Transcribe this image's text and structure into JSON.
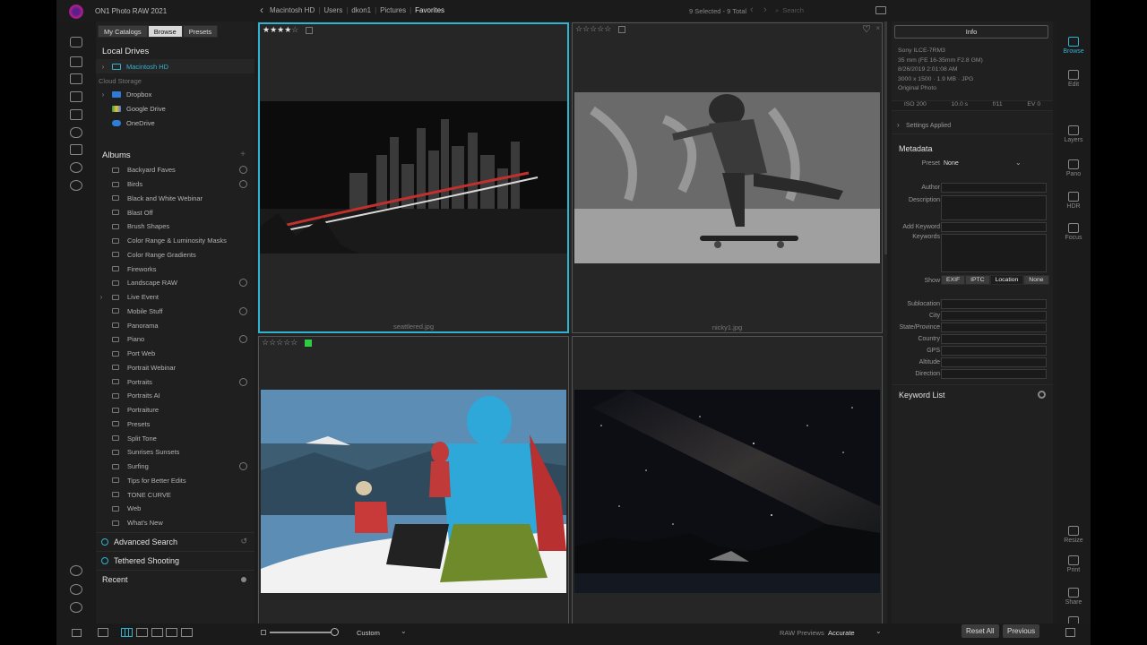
{
  "app_title": "ON1 Photo RAW 2021",
  "breadcrumb": [
    "Macintosh HD",
    "Users",
    "dkon1",
    "Pictures",
    "Favorites"
  ],
  "selection_info": "9 Selected - 9 Total",
  "search_placeholder": "Search",
  "sidebar": {
    "tabs": [
      "My Catalogs",
      "Browse",
      "Presets"
    ],
    "active_tab": "Browse",
    "local_drives_title": "Local Drives",
    "local_drives": [
      {
        "label": "Macintosh HD",
        "selected": true
      }
    ],
    "cloud_storage_title": "Cloud Storage",
    "cloud_storage": [
      {
        "label": "Dropbox",
        "color": "#2f7bd8"
      },
      {
        "label": "Google Drive",
        "color": "#f2c12e"
      },
      {
        "label": "OneDrive",
        "color": "#2c7fd6"
      }
    ],
    "albums_title": "Albums",
    "albums": [
      {
        "label": "Backyard Faves",
        "target": true
      },
      {
        "label": "Birds",
        "target": true
      },
      {
        "label": "Black and White Webinar"
      },
      {
        "label": "Blast Off"
      },
      {
        "label": "Brush Shapes"
      },
      {
        "label": "Color Range & Luminosity Masks"
      },
      {
        "label": "Color Range Gradients"
      },
      {
        "label": "Fireworks"
      },
      {
        "label": "Landscape RAW",
        "target": true
      },
      {
        "label": "Live Event",
        "expandable": true
      },
      {
        "label": "Mobile Stuff",
        "target": true
      },
      {
        "label": "Panorama"
      },
      {
        "label": "Piano",
        "target": true
      },
      {
        "label": "Port Web"
      },
      {
        "label": "Portrait Webinar"
      },
      {
        "label": "Portraits",
        "target": true
      },
      {
        "label": "Portraits AI"
      },
      {
        "label": "Portraiture"
      },
      {
        "label": "Presets"
      },
      {
        "label": "Split Tone"
      },
      {
        "label": "Sunrises Sunsets"
      },
      {
        "label": "Surfing",
        "target": true
      },
      {
        "label": "Tips for Better Edits"
      },
      {
        "label": "TONE CURVE"
      },
      {
        "label": "Web"
      },
      {
        "label": "What's New"
      }
    ],
    "advanced_search": "Advanced Search",
    "tethered_shooting": "Tethered Shooting",
    "recent": "Recent"
  },
  "grid": {
    "cells": [
      {
        "filename": "seattlered.jpg",
        "rating": 4,
        "selected": true,
        "photo": "city-night"
      },
      {
        "filename": "nicky1.jpg",
        "rating": 0,
        "favorite_icon": "heart-icon",
        "photo": "skateboarder"
      },
      {
        "filename": "",
        "rating": 0,
        "color_label": "#2ecc40",
        "photo": "mountaineers"
      },
      {
        "filename": "",
        "rating": 0,
        "photo": "milky-way"
      }
    ]
  },
  "info_panel": {
    "info_button": "Info",
    "camera": "Sony ILCE-7RM3",
    "lens": "35 mm (FE 16-35mm F2.8 GM)",
    "datetime": "8/26/2019 2:01:08 AM",
    "dimensions": "3000 x 1500 · 1.9 MB · JPG",
    "photo_type": "Original Photo",
    "iso": "ISO 200",
    "shutter": "10.0 s",
    "aperture": "f/11",
    "ev": "EV 0",
    "settings_applied": "Settings Applied",
    "metadata_title": "Metadata",
    "preset_label": "Preset",
    "preset_value": "None",
    "fields": [
      "Author",
      "Description",
      "Add Keyword",
      "Keywords"
    ],
    "show_label": "Show",
    "show_options": [
      "EXIF",
      "IPTC",
      "Location",
      "None"
    ],
    "show_active": "Location",
    "location_fields": [
      "Sublocation",
      "City",
      "State/Province",
      "Country",
      "GPS",
      "Altitude",
      "Direction"
    ],
    "keyword_list": "Keyword List"
  },
  "modules": [
    {
      "label": "Browse",
      "active": true
    },
    {
      "label": "Edit"
    },
    {
      "label": "Layers"
    },
    {
      "label": "Pano"
    },
    {
      "label": "HDR"
    },
    {
      "label": "Focus"
    },
    {
      "label": "Resize"
    },
    {
      "label": "Print"
    },
    {
      "label": "Share"
    },
    {
      "label": "Export"
    }
  ],
  "bottom": {
    "thumb_size": "Custom",
    "raw_previews_label": "RAW Previews",
    "raw_previews_value": "Accurate",
    "reset_all": "Reset All",
    "previous": "Previous"
  }
}
